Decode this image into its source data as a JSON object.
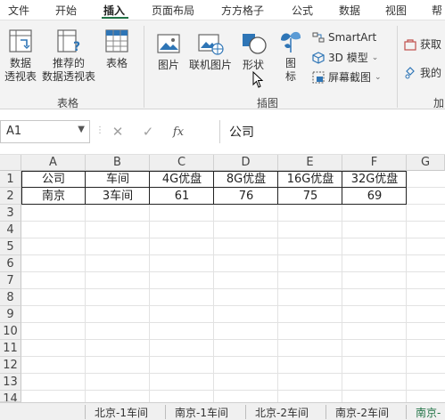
{
  "tabs": [
    "文件",
    "开始",
    "插入",
    "页面布局",
    "方方格子",
    "公式",
    "数据",
    "视图",
    "帮"
  ],
  "active_tab": "插入",
  "colors": {
    "accent": "#217346",
    "ribbon_bg": "#f3f3f3",
    "icon_blue": "#2e75b6"
  },
  "ribbon": {
    "groups": {
      "tables": "表格",
      "illustrations": "插图",
      "addins": "加"
    },
    "buttons": {
      "pivot": [
        "数据",
        "透视表"
      ],
      "recommended_pivot": [
        "推荐的",
        "数据透视表"
      ],
      "table": "表格",
      "pictures": "图片",
      "online_pictures": "联机图片",
      "shapes": "形状",
      "icons": [
        "图",
        "标"
      ],
      "smartart": "SmartArt",
      "model3d": "3D 模型",
      "screenshot": "屏幕截图",
      "get_addins": "获取",
      "my_addins": "我的"
    }
  },
  "formula_bar": {
    "name_box": "A1",
    "cancel": "✕",
    "enter": "✓",
    "fx": "fx",
    "content": "公司"
  },
  "columns": [
    "A",
    "B",
    "C",
    "D",
    "E",
    "F",
    "G"
  ],
  "rows": [
    "1",
    "2",
    "3",
    "4",
    "5",
    "6",
    "7",
    "8",
    "9",
    "10",
    "11",
    "12",
    "13",
    "14"
  ],
  "table": {
    "header": [
      "公司",
      "车间",
      "4G优盘",
      "8G优盘",
      "16G优盘",
      "32G优盘"
    ],
    "row1": [
      "南京",
      "3车间",
      "61",
      "76",
      "75",
      "69"
    ]
  },
  "sheets": [
    "北京-1车间",
    "南京-1车间",
    "北京-2车间",
    "南京-2车间",
    "南京-"
  ]
}
